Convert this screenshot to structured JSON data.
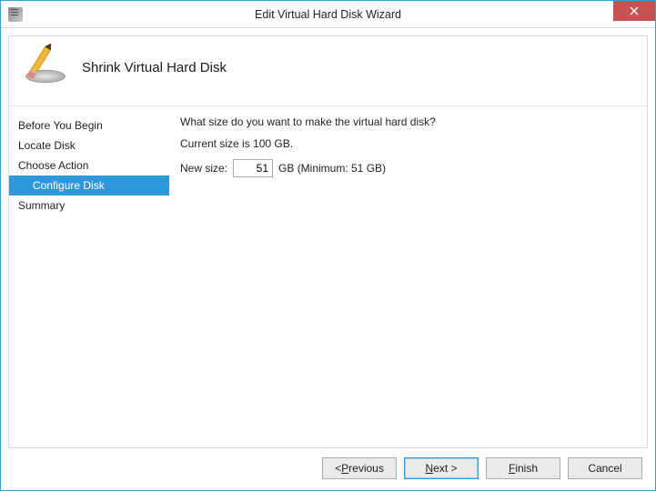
{
  "window": {
    "title": "Edit Virtual Hard Disk Wizard",
    "close_icon": "close-icon"
  },
  "header": {
    "title": "Shrink Virtual Hard Disk"
  },
  "sidebar": {
    "steps": [
      {
        "label": "Before You Begin",
        "selected": false,
        "indent": false
      },
      {
        "label": "Locate Disk",
        "selected": false,
        "indent": false
      },
      {
        "label": "Choose Action",
        "selected": false,
        "indent": false
      },
      {
        "label": "Configure Disk",
        "selected": true,
        "indent": true
      },
      {
        "label": "Summary",
        "selected": false,
        "indent": false
      }
    ]
  },
  "main": {
    "question": "What size do you want to make the virtual hard disk?",
    "current_label": "Current size is 100 GB.",
    "new_size_label": "New size:",
    "new_size_value": "51",
    "new_size_unit_min": "GB (Minimum: 51 GB)"
  },
  "buttons": {
    "previous_pre": "< ",
    "previous_u": "P",
    "previous_post": "revious",
    "next_u": "N",
    "next_mid": "ext >",
    "finish_u": "F",
    "finish_post": "inish",
    "cancel": "Cancel"
  }
}
